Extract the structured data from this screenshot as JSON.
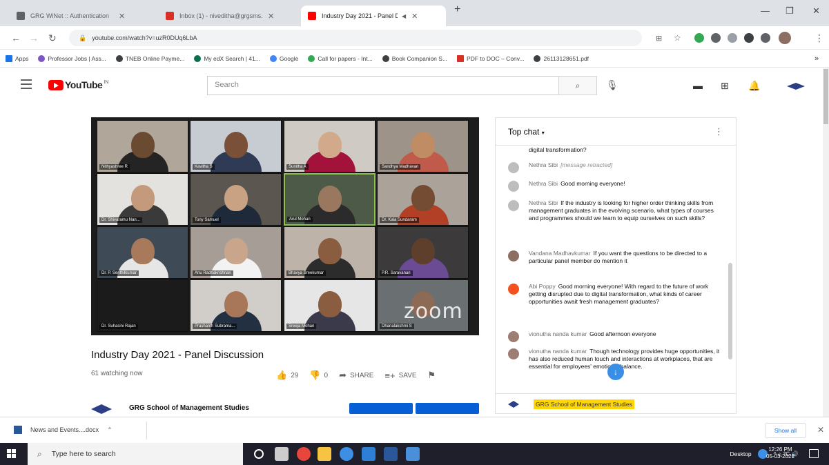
{
  "browser": {
    "tabs": [
      {
        "title": "GRG WiNet :: Authentication",
        "active": false,
        "favicon_color": "#5f6368"
      },
      {
        "title": "Inbox (1) - niveditha@grgsms.ac.in",
        "active": false,
        "favicon_color": "#d93025"
      },
      {
        "title": "Industry Day 2021 - Panel Discussion",
        "active": true,
        "favicon_color": "#ff0000"
      }
    ],
    "new_tab_glyph": "+",
    "url": "youtube.com/watch?v=uzR0DUq6LbA",
    "bookmarks": [
      {
        "label": "Apps",
        "icon_color": "#1a73e8"
      },
      {
        "label": "Professor Jobs | Ass...",
        "icon_color": "#7e57c2"
      },
      {
        "label": "TNEB Online Payme...",
        "icon_color": "#3c4043"
      },
      {
        "label": "My edX Search | 41...",
        "icon_color": "#0b6e4f"
      },
      {
        "label": "Google",
        "icon_color": "#4285f4"
      },
      {
        "label": "Call for papers - Int...",
        "icon_color": "#34a853"
      },
      {
        "label": "Book Companion S...",
        "icon_color": "#3c4043"
      },
      {
        "label": "PDF to DOC – Conv...",
        "icon_color": "#d93025"
      },
      {
        "label": "26113128651.pdf",
        "icon_color": "#3c4043"
      }
    ],
    "more_bookmarks_glyph": "»"
  },
  "youtube": {
    "logo_text": "YouTube",
    "logo_suffix": "IN",
    "search_placeholder": "Search",
    "search_icon": "search-icon",
    "mic_icon": "mic-icon"
  },
  "video": {
    "participants": [
      {
        "name": "Nithyashree R",
        "bg": "#b0a69a",
        "face": "#6b4a32",
        "body": "#242424"
      },
      {
        "name": "Kavitha S",
        "bg": "#c7ccd2",
        "face": "#7a5138",
        "body": "#2f3b55"
      },
      {
        "name": "Sunitha A",
        "bg": "#cfcac4",
        "face": "#d2a98a",
        "body": "#a2123a"
      },
      {
        "name": "Sandhya Madhavan",
        "bg": "#9d9388",
        "face": "#c08c63",
        "body": "#c05a4b"
      },
      {
        "name": "Dr. Shivaramu Nan...",
        "bg": "#e4e2df",
        "face": "#c49a7c",
        "body": "#3a3a3a"
      },
      {
        "name": "Tony Samuel",
        "bg": "#5c5650",
        "face": "#c9a283",
        "body": "#1e2a3a"
      },
      {
        "name": "Arul Mohan",
        "bg": "#4d5a48",
        "face": "#9a7860",
        "body": "#2b2b2b",
        "speaking": true
      },
      {
        "name": "Dr. Kala Sundaram",
        "bg": "#aba39a",
        "face": "#744c33",
        "body": "#b24027"
      },
      {
        "name": "Dr. P. Senthilkumar",
        "bg": "#3e4a56",
        "face": "#a8795a",
        "body": "#e6e6e6"
      },
      {
        "name": "Anu Radhakrishnan",
        "bg": "#a69e96",
        "face": "#c9a68b",
        "body": "#f2f2f2"
      },
      {
        "name": "Bhavya Sreekumar",
        "bg": "#bdb3a8",
        "face": "#8b5d40",
        "body": "#2c2c2c"
      },
      {
        "name": "P.R. Saravanan",
        "bg": "#3d3a3b",
        "face": "#5e3f2c",
        "body": "#6b4b94"
      },
      {
        "name": "Dr. Suhasini Rajan",
        "bg": "#1b1b1b",
        "face": "#1b1b1b",
        "body": "#1b1b1b"
      },
      {
        "name": "Prashanth Subrama...",
        "bg": "#d1cec9",
        "face": "#a87658",
        "body": "#233042"
      },
      {
        "name": "Sreeja Mohan",
        "bg": "#e6e6e6",
        "face": "#8b5d40",
        "body": "#3a3a4a"
      },
      {
        "name": "Dhanalakshmi S",
        "bg": "#6a6f72",
        "face": "#8c6a55",
        "body": "#6a6f72"
      }
    ],
    "watermark": "zoom",
    "title": "Industry Day 2021 - Panel Discussion",
    "viewers": "61 watching now",
    "likes": "29",
    "dislikes": "0",
    "share_label": "SHARE",
    "save_label": "SAVE",
    "channel_name": "GRG School of Management Studies",
    "channel_color": "#2c3e85",
    "button_color": "#065fd4"
  },
  "chat": {
    "title": "Top chat",
    "messages": [
      {
        "author": "",
        "text": "digital transformation?",
        "avatar": "none"
      },
      {
        "author": "Nethra Sibi",
        "text": "[message retracted]",
        "retracted": true,
        "avatar": "#bdbdbd"
      },
      {
        "author": "Nethra Sibi",
        "text": "Good morning everyone!",
        "avatar": "#bdbdbd"
      },
      {
        "author": "Nethra Sibi",
        "text": "If the industry is looking for higher order thinking skills from management graduates in the evolving scenario, what types of courses and programmes should we learn to equip ourselves on such skills?",
        "avatar": "#bdbdbd"
      },
      {
        "author": "Vandana Madhavkumar",
        "text": "If you want the questions to be directed to a particular panel member do mention it",
        "avatar": "#8d6e63"
      },
      {
        "author": "Abi Poppy",
        "text": "Good morning everyone! With regard to the future of work getting disrupted due to digital transformation, what kinds of career opportunities await fresh management graduates?",
        "avatar": "#f4511e"
      },
      {
        "author": "vionutha nanda kumar",
        "text": "Good afternoon everyone",
        "avatar": "#9e7d72"
      },
      {
        "author": "vionutha nanda kumar",
        "text": "Though technology provides huge opportunities, it has also reduced human touch and interactions at workplaces, that are essential for employees' emotional balance.",
        "avatar": "#9e7d72"
      }
    ],
    "pinned_channel": "GRG School of Management Studies"
  },
  "download_shelf": {
    "file_name": "News and Events....docx",
    "show_all": "Show all"
  },
  "taskbar": {
    "search_placeholder": "Type here to search",
    "apps": [
      {
        "name": "cortana",
        "color": "#ffffff"
      },
      {
        "name": "task-view",
        "color": "#cccccc"
      },
      {
        "name": "chrome",
        "color": "#e8453c"
      },
      {
        "name": "file-explorer",
        "color": "#f6c343"
      },
      {
        "name": "edge",
        "color": "#3d8fe6"
      },
      {
        "name": "store",
        "color": "#2e7fd6"
      },
      {
        "name": "word",
        "color": "#2b579a"
      },
      {
        "name": "photos",
        "color": "#4a90d9"
      }
    ],
    "desktop_label": "Desktop",
    "tray_icons": "^  ⌂  ℃  🔊",
    "time": "12:26 PM",
    "date": "05-03-2021"
  }
}
